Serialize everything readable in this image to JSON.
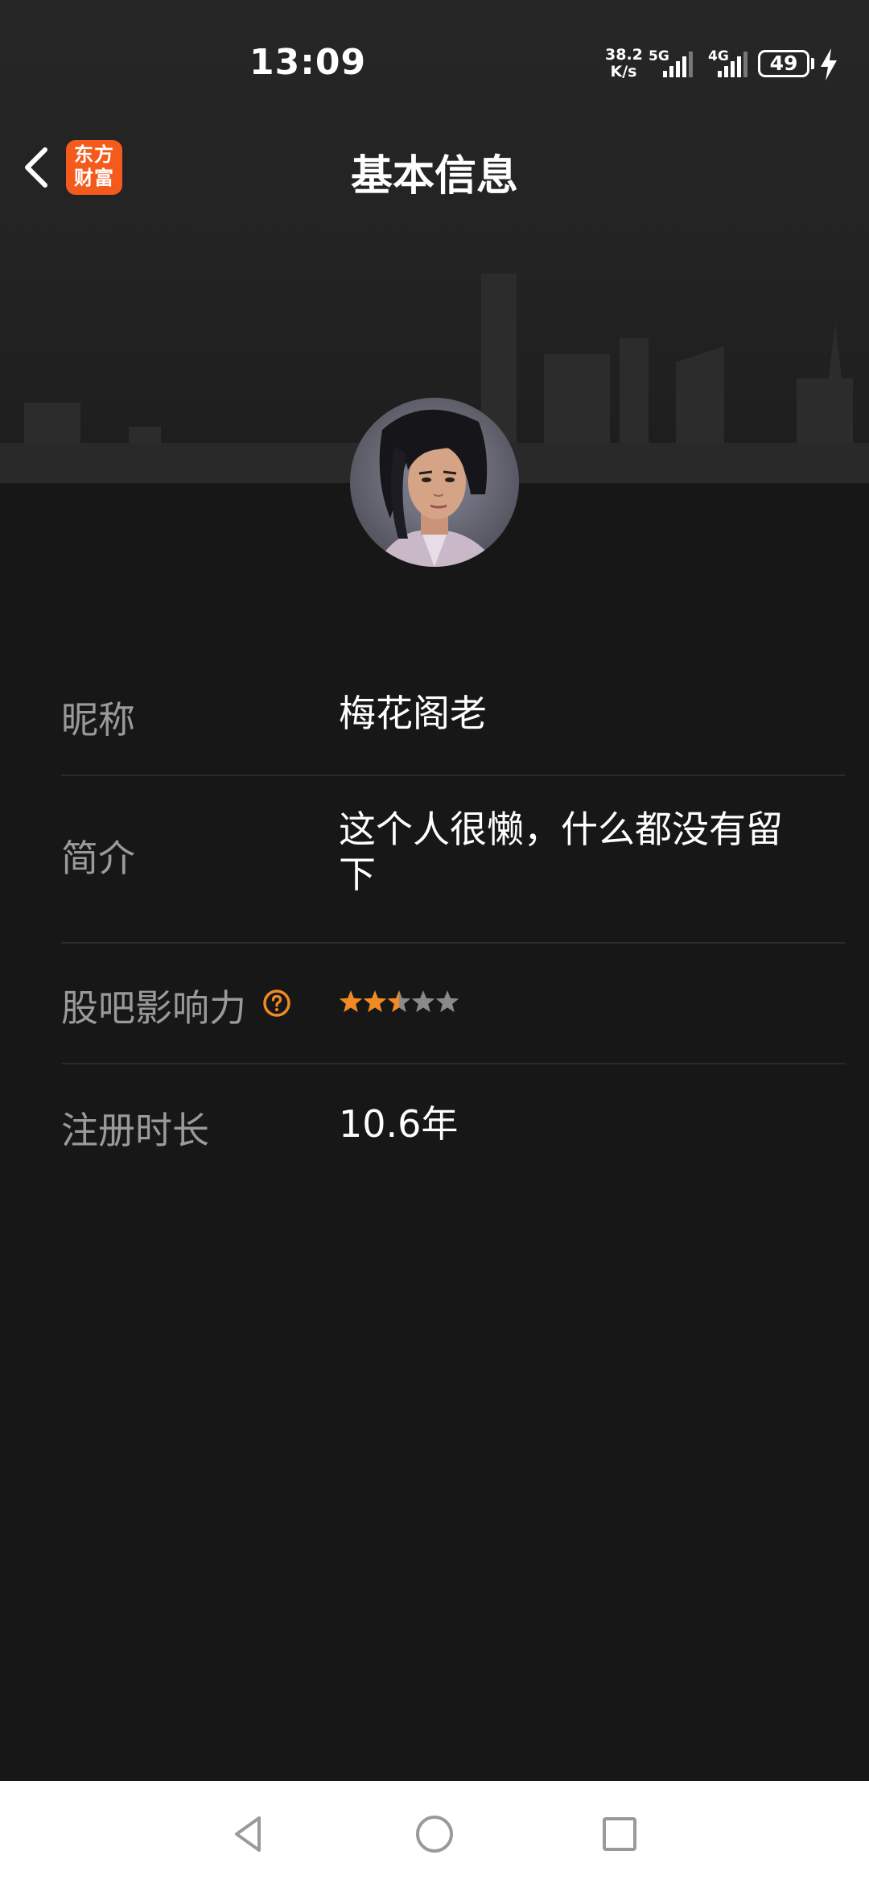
{
  "status_bar": {
    "time": "13:09",
    "net_speed_value": "38.2",
    "net_speed_unit": "K/s",
    "sim1_type": "5G",
    "sim2_type": "4G",
    "battery_level": "49"
  },
  "header": {
    "logo_line1": "东方",
    "logo_line2": "财富",
    "title": "基本信息"
  },
  "profile": {
    "rows": [
      {
        "label": "昵称",
        "value": "梅花阁老"
      },
      {
        "label": "简介",
        "value_line1": "这个人很懒，什么都没有留",
        "value_line2": "下"
      },
      {
        "label": "股吧影响力",
        "rating": 2.5,
        "rating_max": 5
      },
      {
        "label": "注册时长",
        "value": "10.6年"
      }
    ]
  },
  "colors": {
    "background": "#171717",
    "label_text": "#9a9a9a",
    "accent_orange": "#f08a24",
    "logo_orange": "#f45a1b",
    "star_empty": "#8a8a8a"
  },
  "icons": {
    "back": "chevron-left-icon",
    "help": "question-circle-icon",
    "charging": "lightning-icon",
    "nav_back": "triangle-back-icon",
    "nav_home": "circle-home-icon",
    "nav_recents": "square-recents-icon"
  }
}
